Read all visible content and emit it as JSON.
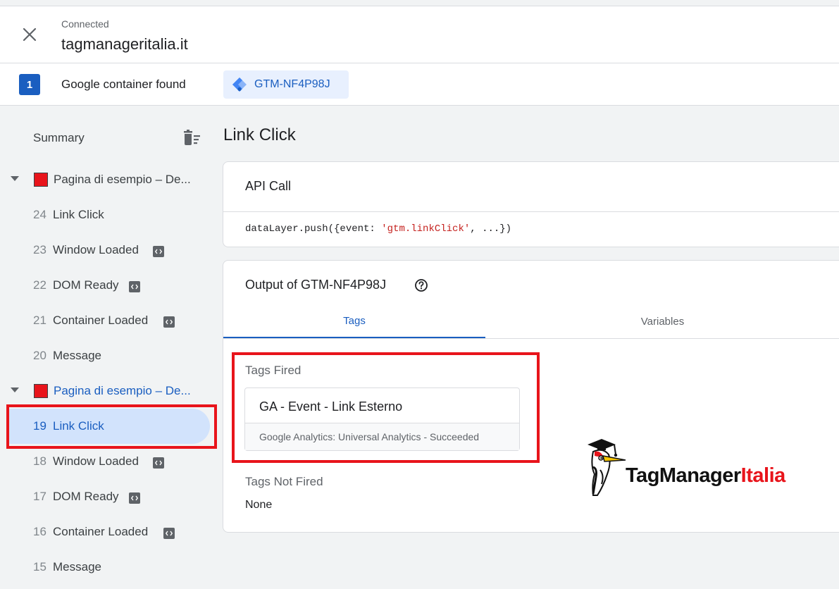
{
  "header": {
    "status": "Connected",
    "domain": "tagmanageritalia.it"
  },
  "container_bar": {
    "count": "1",
    "found_label": "Google container found",
    "container_id": "GTM-NF4P98J"
  },
  "sidebar": {
    "summary_label": "Summary",
    "pages": [
      {
        "label": "Pagina di esempio – De...",
        "events": [
          {
            "num": "24",
            "label": "Link Click",
            "code": false
          },
          {
            "num": "23",
            "label": "Window Loaded",
            "code": true
          },
          {
            "num": "22",
            "label": "DOM Ready",
            "code": true
          },
          {
            "num": "21",
            "label": "Container Loaded",
            "code": true
          },
          {
            "num": "20",
            "label": "Message",
            "code": false
          }
        ]
      },
      {
        "label": "Pagina di esempio – De...",
        "events": [
          {
            "num": "19",
            "label": "Link Click",
            "code": false
          },
          {
            "num": "18",
            "label": "Window Loaded",
            "code": true
          },
          {
            "num": "17",
            "label": "DOM Ready",
            "code": true
          },
          {
            "num": "16",
            "label": "Container Loaded",
            "code": true
          },
          {
            "num": "15",
            "label": "Message",
            "code": false
          }
        ]
      }
    ]
  },
  "main": {
    "title": "Link Click",
    "api_call": {
      "title": "API Call",
      "code_prefix": "dataLayer.push({event: ",
      "code_string": "'gtm.linkClick'",
      "code_suffix": ", ...})"
    },
    "output": {
      "title": "Output of GTM-NF4P98J",
      "tabs": [
        "Tags",
        "Variables"
      ],
      "tags_fired_label": "Tags Fired",
      "fired_tag": {
        "name": "GA - Event - Link Esterno",
        "type": "Google Analytics: Universal Analytics - Succeeded"
      },
      "tags_not_fired_label": "Tags Not Fired",
      "not_fired_value": "None"
    }
  },
  "logo": {
    "text_main": "TagManager",
    "text_accent": "Italia"
  },
  "colors": {
    "accent_blue": "#1a5ec0",
    "selected_bg": "#d2e3fc",
    "highlight_red": "#e8141b",
    "page_bg": "#f1f3f4"
  }
}
